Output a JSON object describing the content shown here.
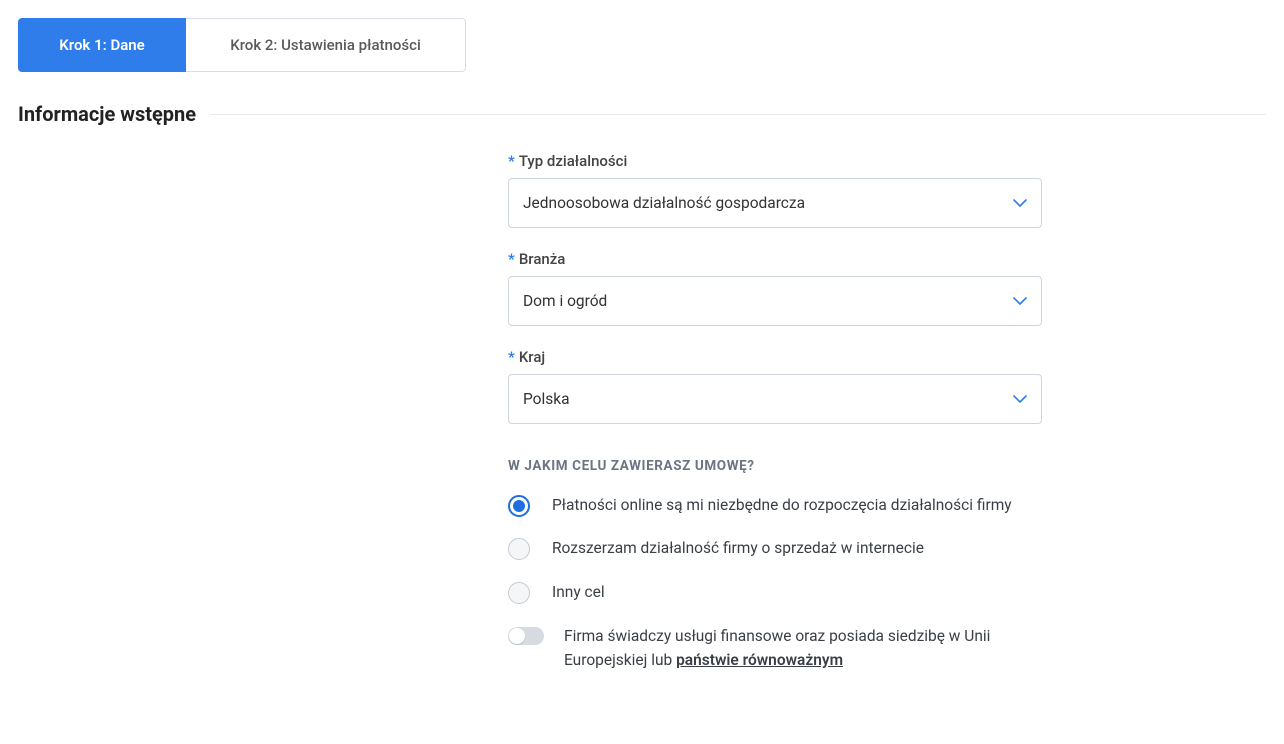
{
  "tabs": {
    "step1": "Krok 1: Dane",
    "step2": "Krok 2: Ustawienia płatności"
  },
  "section": {
    "title": "Informacje wstępne"
  },
  "fields": {
    "type": {
      "label": "Typ działalności",
      "value": "Jednoosobowa działalność gospodarcza"
    },
    "industry": {
      "label": "Branża",
      "value": "Dom i ogród"
    },
    "country": {
      "label": "Kraj",
      "value": "Polska"
    },
    "required_mark": "*"
  },
  "purpose": {
    "heading": "W jakim celu zawierasz umowę?",
    "option1": "Płatności online są mi niezbędne do rozpoczęcia działalności firmy",
    "option2": "Rozszerzam działalność firmy o sprzedaż w internecie",
    "option3": "Inny cel"
  },
  "financial_toggle": {
    "text_a": "Firma świadczy usługi finansowe oraz posiada siedzibę w Unii Europejskiej lub ",
    "text_b": "państwie równoważnym"
  }
}
